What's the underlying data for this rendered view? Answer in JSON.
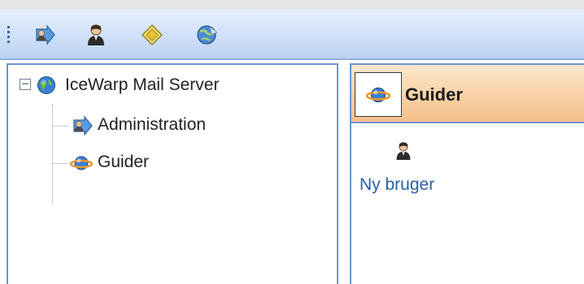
{
  "toolbar": {
    "buttons": [
      {
        "icon": "administration-icon"
      },
      {
        "icon": "user-icon"
      },
      {
        "icon": "domain-icon"
      },
      {
        "icon": "wizard-globe-icon"
      }
    ]
  },
  "tree": {
    "root_label": "IceWarp Mail Server",
    "expander_symbol": "−",
    "children": [
      {
        "label": "Administration",
        "icon": "administration-icon"
      },
      {
        "label": "Guider",
        "icon": "guider-icon"
      }
    ]
  },
  "panel": {
    "title": "Guider",
    "items": [
      {
        "label": "Ny bruger",
        "icon": "user-icon"
      }
    ]
  },
  "colors": {
    "toolbar_bg": "#cfe0f7",
    "panel_border": "#6f95d1",
    "header_bg": "#f9cfa2",
    "link": "#2a5fa8"
  }
}
